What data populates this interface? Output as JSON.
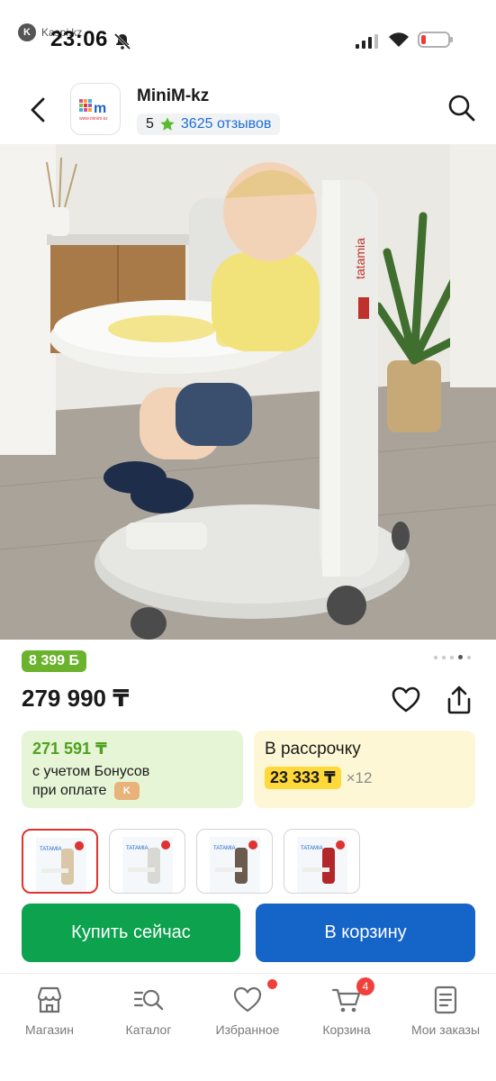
{
  "status_bar": {
    "app_name": "Kaspi.kz",
    "time": "23:06"
  },
  "header": {
    "shop_name": "MiniM-kz",
    "rating": "5",
    "reviews": "3625 отзывов",
    "logo_url_text": "www.minim.kz"
  },
  "product": {
    "bonus_badge": "8 399 Б",
    "price": "279 990 ₸",
    "images_count": 5,
    "active_image_index": 3
  },
  "bonus_card": {
    "price": "271 591 ₸",
    "line1": "с учетом Бонусов",
    "line2": "при оплате"
  },
  "installment_card": {
    "title": "В рассрочку",
    "amount": "23 333 ₸",
    "months": "×12"
  },
  "thumbnails": [
    {
      "brand": "TATAMIA",
      "color": "#d9c7a8",
      "selected": true
    },
    {
      "brand": "TATAMIA",
      "color": "#d8d8d5",
      "selected": false
    },
    {
      "brand": "TATAMIA",
      "color": "#6b5a4e",
      "selected": false
    },
    {
      "brand": "TATAMIA",
      "color": "#b3262a",
      "selected": false
    }
  ],
  "actions": {
    "buy_now": "Купить сейчас",
    "add_to_cart": "В корзину"
  },
  "bottom_nav": {
    "items": [
      {
        "label": "Магазин",
        "icon": "store-icon"
      },
      {
        "label": "Каталог",
        "icon": "catalog-icon"
      },
      {
        "label": "Избранное",
        "icon": "heart-icon"
      },
      {
        "label": "Корзина",
        "icon": "cart-icon",
        "badge": "4"
      },
      {
        "label": "Мои заказы",
        "icon": "orders-icon"
      }
    ]
  },
  "colors": {
    "buy_button": "#0ca24e",
    "cart_button": "#1565c8",
    "bonus_green": "#6bb22d",
    "installment_yellow": "#ffd83a",
    "badge_red": "#f1403b"
  }
}
